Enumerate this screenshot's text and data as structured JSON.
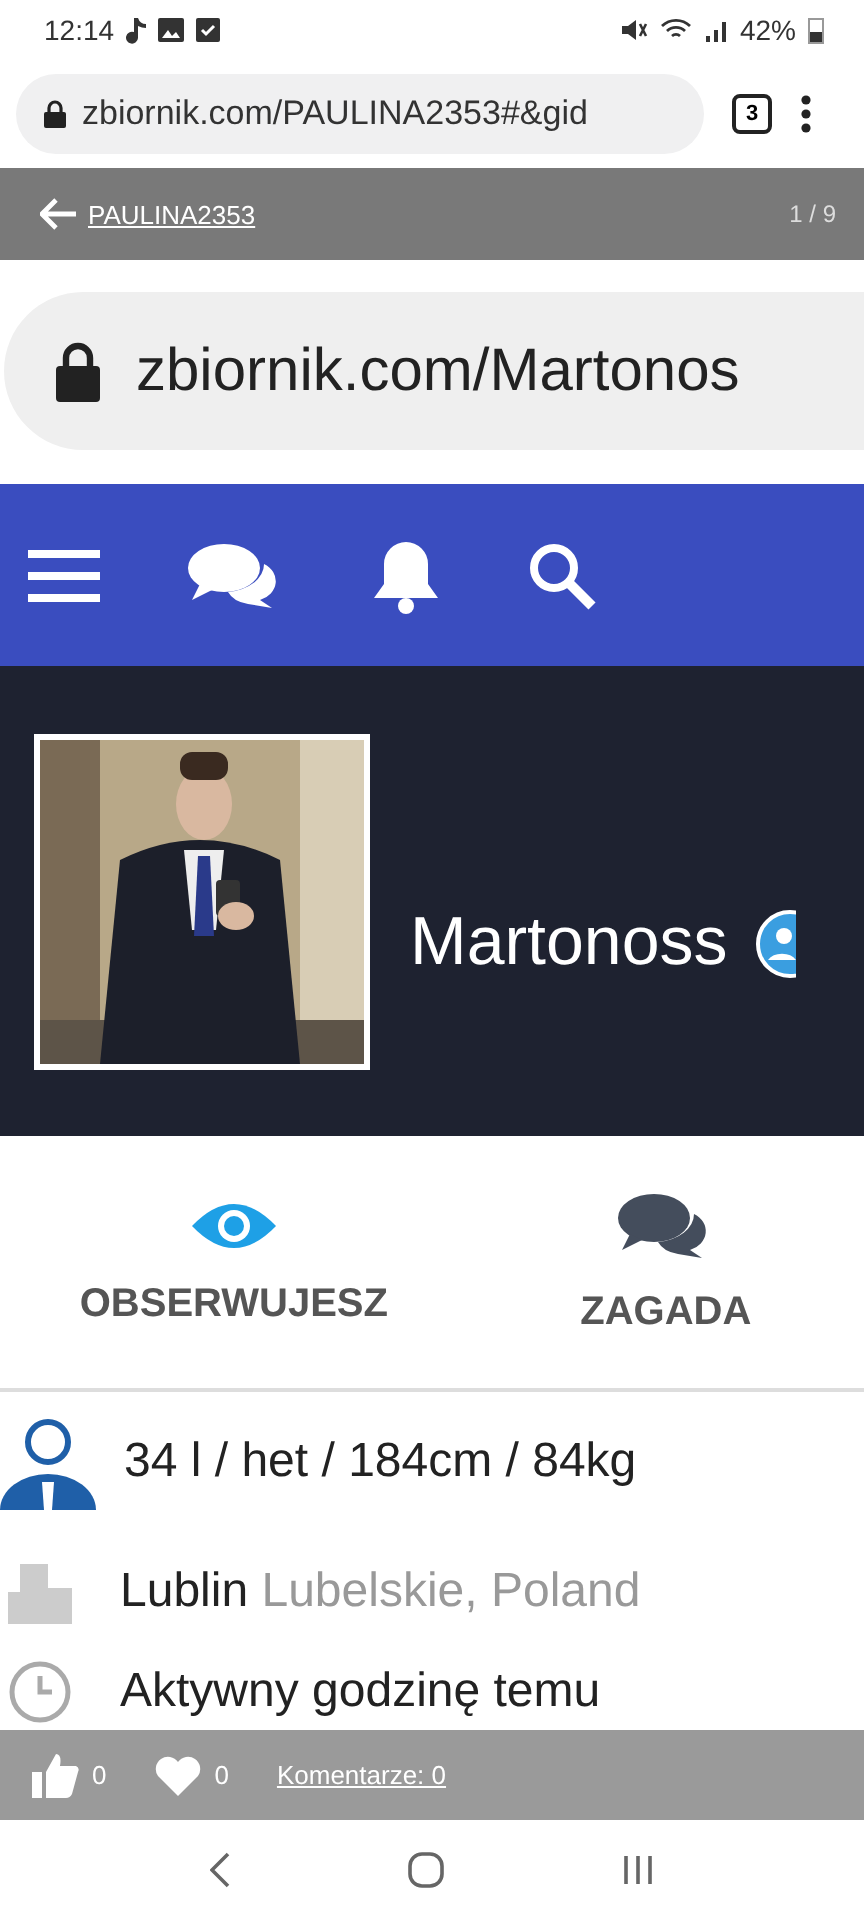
{
  "status_bar": {
    "time": "12:14",
    "battery": "42%"
  },
  "browser": {
    "url": "zbiornik.com/PAULINA2353#&gid",
    "tab_count": "3"
  },
  "gallery": {
    "user": "PAULINA2353",
    "counter": "1 / 9",
    "likes": "0",
    "hearts": "0",
    "comments": "Komentarze: 0"
  },
  "screenshot": {
    "url": "zbiornik.com/Martonos",
    "profile_name": "Martonoss",
    "tabs": [
      {
        "label": "OBSERWUJESZ",
        "selected": true
      },
      {
        "label": "ZAGADA",
        "selected": false
      }
    ],
    "details": [
      {
        "kind": "person",
        "text": "34 l / het / 184cm / 84kg"
      },
      {
        "kind": "city",
        "text": "Lublin",
        "extra": "Lubelskie, Poland"
      },
      {
        "kind": "clock",
        "text": "Aktywny godzinę temu"
      }
    ]
  }
}
